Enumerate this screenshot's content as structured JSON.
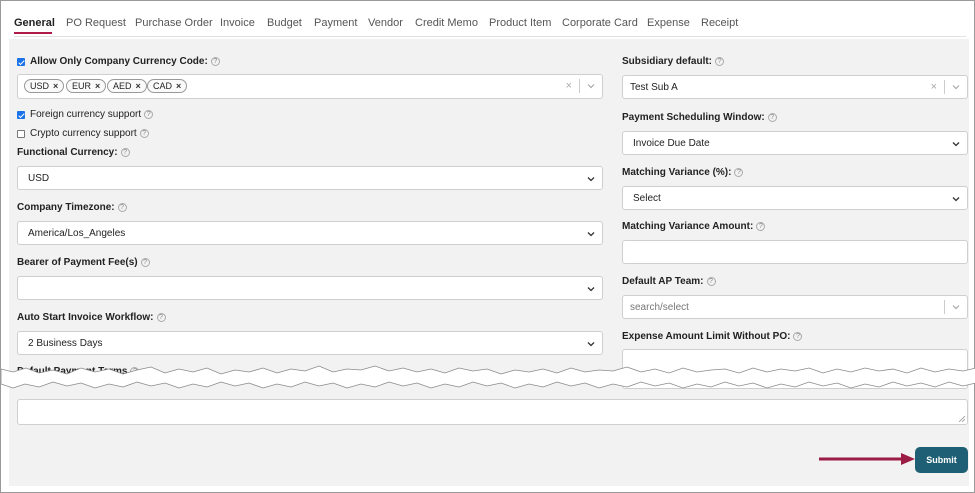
{
  "tabs": [
    "General",
    "PO Request",
    "Purchase Order",
    "Invoice",
    "Budget",
    "Payment",
    "Vendor",
    "Credit Memo",
    "Product Item",
    "Corporate Card",
    "Expense",
    "Receipt"
  ],
  "left": {
    "allow_currency_label": "Allow Only Company Currency Code:",
    "currency_chips": [
      "USD",
      "EUR",
      "AED",
      "CAD"
    ],
    "foreign_currency_label": "Foreign currency support",
    "crypto_currency_label": "Crypto currency support",
    "functional_currency_label": "Functional Currency:",
    "functional_currency_value": "USD",
    "timezone_label": "Company Timezone:",
    "timezone_value": "America/Los_Angeles",
    "bearer_label": "Bearer of Payment Fee(s)",
    "bearer_value": "",
    "auto_start_label": "Auto Start Invoice Workflow:",
    "auto_start_value": "2 Business Days",
    "payment_terms_label": "Default Payment Terms"
  },
  "right": {
    "subsidiary_label": "Subsidiary default:",
    "subsidiary_value": "Test Sub A",
    "scheduling_label": "Payment Scheduling Window:",
    "scheduling_value": "Invoice Due Date",
    "variance_pct_label": "Matching Variance (%):",
    "variance_pct_value": "Select",
    "variance_amt_label": "Matching Variance Amount:",
    "ap_team_label": "Default AP Team:",
    "ap_team_placeholder": "search/select",
    "expense_limit_label": "Expense Amount Limit Without PO:"
  },
  "checkboxes": {
    "allow_currency": true,
    "foreign_currency": true,
    "crypto_currency": false
  },
  "submit_label": "Submit",
  "colors": {
    "tab_underline": "#b01c4a",
    "submit_bg": "#1f5f75",
    "arrow": "#9b1c45"
  }
}
